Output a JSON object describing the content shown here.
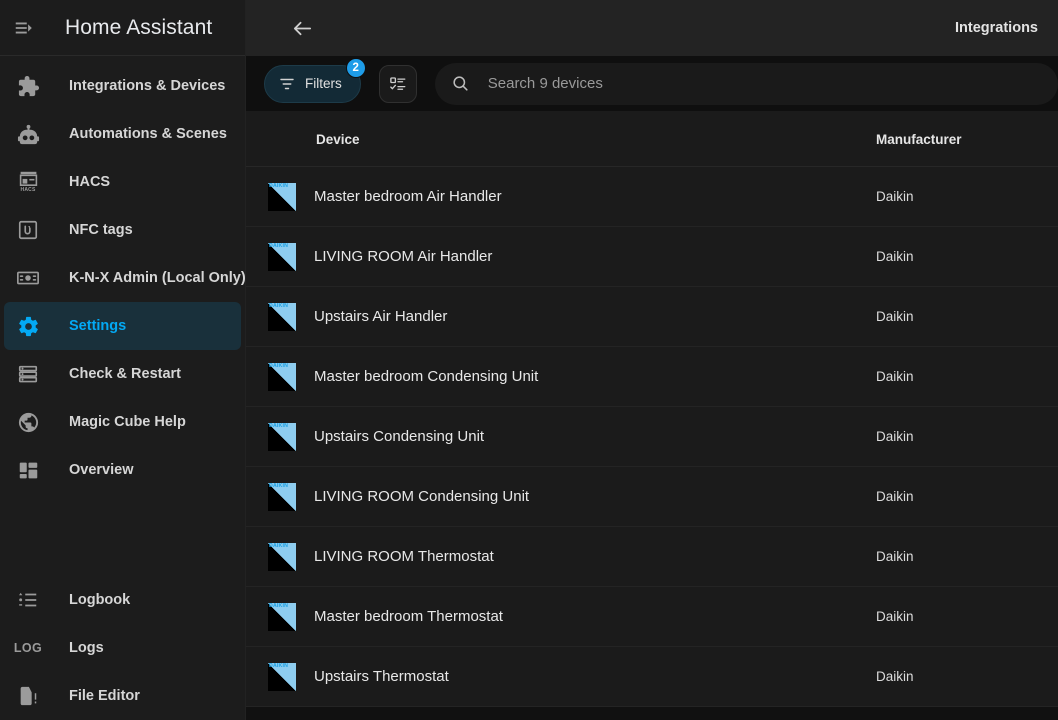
{
  "sidebar": {
    "menu_icon": "menu-open-icon",
    "title": "Home Assistant",
    "items": [
      {
        "label": "Integrations & Devices",
        "icon": "puzzle-icon",
        "active": false
      },
      {
        "label": "Automations & Scenes",
        "icon": "robot-icon",
        "active": false
      },
      {
        "label": "HACS",
        "icon": "hacs-storefront-icon",
        "active": false
      },
      {
        "label": "NFC tags",
        "icon": "nfc-icon",
        "active": false
      },
      {
        "label": "K-N-X Admin (Local Only)",
        "icon": "knx-chip-icon",
        "active": false
      },
      {
        "label": "Settings",
        "icon": "gear-icon",
        "active": true
      },
      {
        "label": "Check & Restart",
        "icon": "server-icon",
        "active": false
      },
      {
        "label": "Magic Cube Help",
        "icon": "globe-icon",
        "active": false
      },
      {
        "label": "Overview",
        "icon": "dashboard-grid-icon",
        "active": false
      }
    ],
    "bottom_items": [
      {
        "label": "Logbook",
        "icon": "format-list-icon",
        "active": false
      },
      {
        "label": "Logs",
        "icon": "log-text-icon",
        "active": false
      },
      {
        "label": "File Editor",
        "icon": "file-alert-icon",
        "active": false
      }
    ]
  },
  "topbar": {
    "back_icon": "arrow-left-icon",
    "title": "Integrations"
  },
  "toolbar": {
    "filters_label": "Filters",
    "filters_icon": "filter-icon",
    "filters_badge": "2",
    "group_button_icon": "list-settings-icon",
    "search_icon": "search-icon",
    "search_placeholder": "Search 9 devices",
    "search_value": ""
  },
  "table": {
    "columns": [
      {
        "key": "device",
        "label": "Device"
      },
      {
        "key": "manufacturer",
        "label": "Manufacturer"
      }
    ],
    "rows": [
      {
        "icon": "daikin-logo-icon",
        "device": "Master bedroom Air Handler",
        "manufacturer": "Daikin"
      },
      {
        "icon": "daikin-logo-icon",
        "device": "LIVING ROOM Air Handler",
        "manufacturer": "Daikin"
      },
      {
        "icon": "daikin-logo-icon",
        "device": "Upstairs Air Handler",
        "manufacturer": "Daikin"
      },
      {
        "icon": "daikin-logo-icon",
        "device": "Master bedroom Condensing Unit",
        "manufacturer": "Daikin"
      },
      {
        "icon": "daikin-logo-icon",
        "device": "Upstairs Condensing Unit",
        "manufacturer": "Daikin"
      },
      {
        "icon": "daikin-logo-icon",
        "device": "LIVING ROOM Condensing Unit",
        "manufacturer": "Daikin"
      },
      {
        "icon": "daikin-logo-icon",
        "device": "LIVING ROOM Thermostat",
        "manufacturer": "Daikin"
      },
      {
        "icon": "daikin-logo-icon",
        "device": "Master bedroom Thermostat",
        "manufacturer": "Daikin"
      },
      {
        "icon": "daikin-logo-icon",
        "device": "Upstairs Thermostat",
        "manufacturer": "Daikin"
      }
    ]
  },
  "colors": {
    "accent": "#03a9f4",
    "badge": "#1e9ce8",
    "sidebar_bg": "#1c1c1c",
    "row_bg": "#1b1b1b",
    "page_bg": "#111111",
    "daikin_blue": "#8ecdf0"
  }
}
